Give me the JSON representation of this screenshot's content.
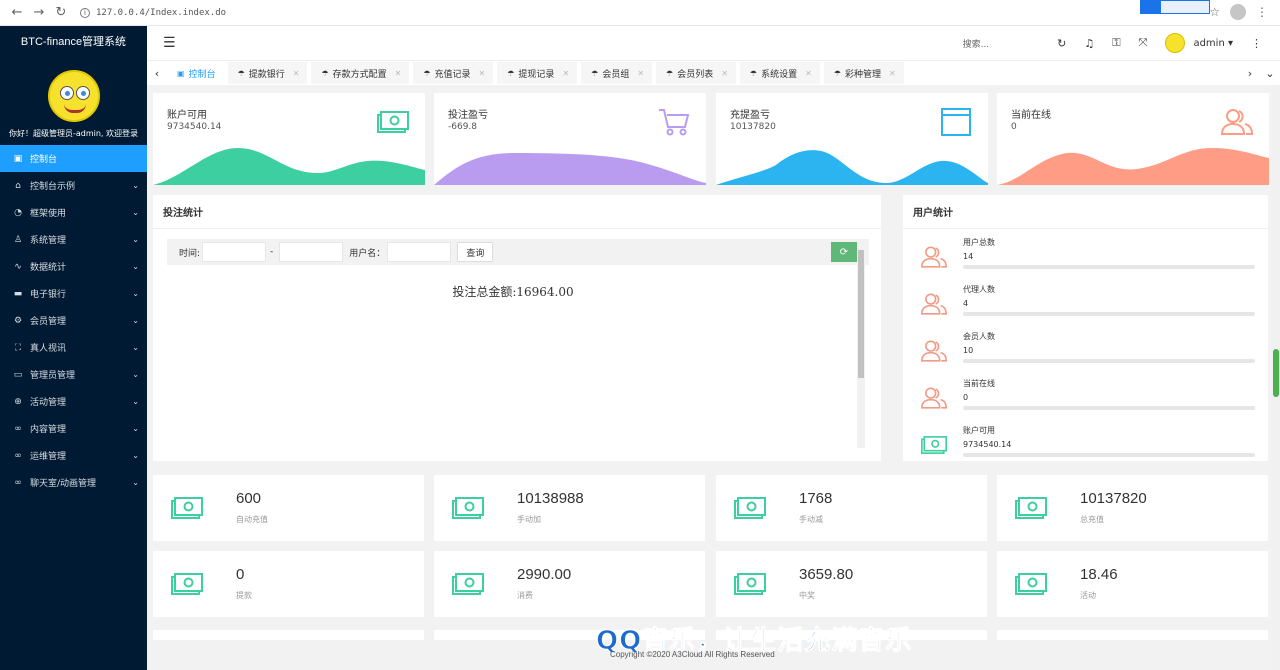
{
  "browser": {
    "url": "127.0.0.4/Index.index.do"
  },
  "sidebar": {
    "title": "BTC-finance管理系统",
    "welcome": "你好！超级管理员-admin, 欢迎登录",
    "items": [
      {
        "label": "控制台",
        "icon": "monitor-icon"
      },
      {
        "label": "控制台示例",
        "icon": "home-icon"
      },
      {
        "label": "框架使用",
        "icon": "gauge-icon"
      },
      {
        "label": "系统管理",
        "icon": "user-icon"
      },
      {
        "label": "数据统计",
        "icon": "pulse-icon"
      },
      {
        "label": "电子银行",
        "icon": "bank-icon"
      },
      {
        "label": "会员管理",
        "icon": "gear-icon"
      },
      {
        "label": "真人视讯",
        "icon": "video-icon"
      },
      {
        "label": "管理员管理",
        "icon": "card-icon"
      },
      {
        "label": "活动管理",
        "icon": "plus-circle-icon"
      },
      {
        "label": "内容管理",
        "icon": "link-icon"
      },
      {
        "label": "运维管理",
        "icon": "link-icon"
      },
      {
        "label": "聊天室/动画管理",
        "icon": "link-icon"
      }
    ]
  },
  "header": {
    "search_placeholder": "搜索...",
    "username": "admin"
  },
  "tabs": [
    {
      "label": "控制台",
      "active": true
    },
    {
      "label": "提款银行"
    },
    {
      "label": "存款方式配置"
    },
    {
      "label": "充值记录"
    },
    {
      "label": "提现记录"
    },
    {
      "label": "会员组"
    },
    {
      "label": "会员列表"
    },
    {
      "label": "系统设置"
    },
    {
      "label": "彩种管理"
    }
  ],
  "stat_cards": [
    {
      "label": "账户可用",
      "value": "9734540.14",
      "color": "#3dcf9f",
      "icon": "money-icon"
    },
    {
      "label": "投注盈亏",
      "value": "-669.8",
      "color": "#b99cf0",
      "icon": "cart-icon"
    },
    {
      "label": "充提盈亏",
      "value": "10137820",
      "color": "#2bb4ef",
      "icon": "window-icon"
    },
    {
      "label": "当前在线",
      "value": "0",
      "color": "#ff9c85",
      "icon": "users-icon"
    }
  ],
  "bet_stats": {
    "title": "投注统计",
    "time_label": "时间:",
    "dash": "-",
    "username_label": "用户名：",
    "query_button": "查询",
    "total_text": "投注总金额:16964.00"
  },
  "user_stats": {
    "title": "用户统计",
    "rows": [
      {
        "label": "用户总数",
        "value": "14",
        "icon": "users-icon"
      },
      {
        "label": "代理人数",
        "value": "4",
        "icon": "users-icon"
      },
      {
        "label": "会员人数",
        "value": "10",
        "icon": "users-icon"
      },
      {
        "label": "当前在线",
        "value": "0",
        "icon": "users-icon"
      },
      {
        "label": "账户可用",
        "value": "9734540.14",
        "icon": "money-icon"
      }
    ]
  },
  "mini_cards": [
    {
      "value": "600",
      "label": "自动充值"
    },
    {
      "value": "10138988",
      "label": "手动加"
    },
    {
      "value": "1768",
      "label": "手动减"
    },
    {
      "value": "10137820",
      "label": "总充值"
    },
    {
      "value": "0",
      "label": "提款"
    },
    {
      "value": "2990.00",
      "label": "消费"
    },
    {
      "value": "3659.80",
      "label": "中奖"
    },
    {
      "value": "18.46",
      "label": "活动"
    }
  ],
  "footer": {
    "copyright": "Copyright ©2020 A3Cloud All Rights Reserved",
    "watermark": "QQ音乐，让生活充满音乐"
  }
}
